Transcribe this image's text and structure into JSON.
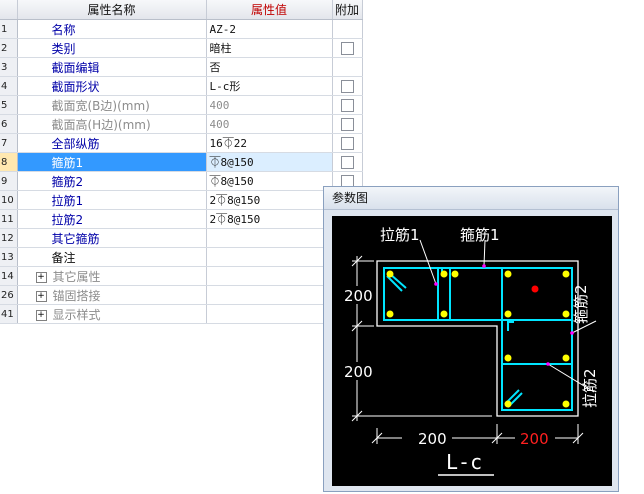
{
  "table": {
    "headers": {
      "name": "属性名称",
      "value": "属性值",
      "extra": "附加"
    },
    "rows": [
      {
        "num": "1",
        "name": "名称",
        "value": "AZ-2",
        "check": false
      },
      {
        "num": "2",
        "name": "类别",
        "value": "暗柱",
        "check": true
      },
      {
        "num": "3",
        "name": "截面编辑",
        "value": "否",
        "check": false
      },
      {
        "num": "4",
        "name": "截面形状",
        "value": "L-c形",
        "check": true
      },
      {
        "num": "5",
        "name": "截面宽(B边)(mm)",
        "value": "400",
        "check": true
      },
      {
        "num": "6",
        "name": "截面高(H边)(mm)",
        "value": "400",
        "check": true
      },
      {
        "num": "7",
        "name": "全部纵筋",
        "value": "16⏁22",
        "check": true
      },
      {
        "num": "8",
        "name": "箍筋1",
        "value": "⏁8@150",
        "check": true
      },
      {
        "num": "9",
        "name": "箍筋2",
        "value": "⏁8@150",
        "check": true
      },
      {
        "num": "10",
        "name": "拉筋1",
        "value": "2⏁8@150",
        "check": false
      },
      {
        "num": "11",
        "name": "拉筋2",
        "value": "2⏁8@150",
        "check": false
      },
      {
        "num": "12",
        "name": "其它箍筋",
        "value": "",
        "check": false
      },
      {
        "num": "13",
        "name": "备注",
        "value": "",
        "check": false
      },
      {
        "num": "14",
        "name": "其它属性",
        "value": "",
        "check": false
      },
      {
        "num": "26",
        "name": "锚固搭接",
        "value": "",
        "check": false
      },
      {
        "num": "41",
        "name": "显示样式",
        "value": "",
        "check": false
      }
    ]
  },
  "panel": {
    "title": "参数图",
    "labels": {
      "tie1": "拉筋1",
      "stirrup1": "箍筋1",
      "stirrup2": "箍筋2",
      "tie2": "拉筋2",
      "dim_top_height": "200",
      "dim_mid_height": "200",
      "dim_bottom_left": "200",
      "dim_bottom_right": "200",
      "shape": "L-c"
    }
  },
  "colors": {
    "selected_row": "#3399ff",
    "header_value": "#c00000",
    "rebar": "#00e5ff",
    "bar_dot": "#ffff00",
    "center_dot": "#ff0000",
    "dim_red": "#ff2020"
  }
}
